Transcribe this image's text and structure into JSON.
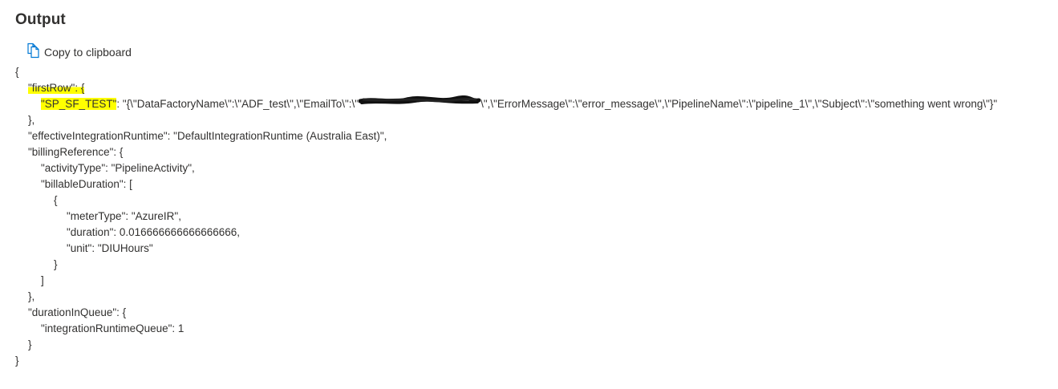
{
  "panel": {
    "title": "Output",
    "copy_label": "Copy to clipboard",
    "copy_icon": "copy-icon",
    "highlight_color": "#ffff00"
  },
  "json": {
    "open_brace": "{",
    "first_row_key": "\"firstRow\": {",
    "sp_key": "\"SP_SF_TEST\"",
    "sp_value_start": ": \"{\\\"DataFactoryName\\\":\\\"ADF_test\\\",\\\"EmailTo\\\":\\\"",
    "sp_value_end": "\\\",\\\"ErrorMessage\\\":\\\"error_message\\\",\\\"PipelineName\\\":\\\"pipeline_1\\\",\\\"Subject\\\":\\\"something went wrong\\\"}\"",
    "first_row_close": "},",
    "effective_runtime": "\"effectiveIntegrationRuntime\": \"DefaultIntegrationRuntime (Australia East)\",",
    "billing_key": "\"billingReference\": {",
    "activity_type": "\"activityType\": \"PipelineActivity\",",
    "billable_duration": "\"billableDuration\": [",
    "obj_open": "{",
    "meter_type": "\"meterType\": \"AzureIR\",",
    "duration": "\"duration\": 0.016666666666666666,",
    "unit": "\"unit\": \"DIUHours\"",
    "obj_close": "}",
    "array_close": "]",
    "billing_close": "},",
    "queue_key": "\"durationInQueue\": {",
    "queue_value": "\"integrationRuntimeQueue\": 1",
    "queue_close": "}",
    "close_brace": "}"
  }
}
